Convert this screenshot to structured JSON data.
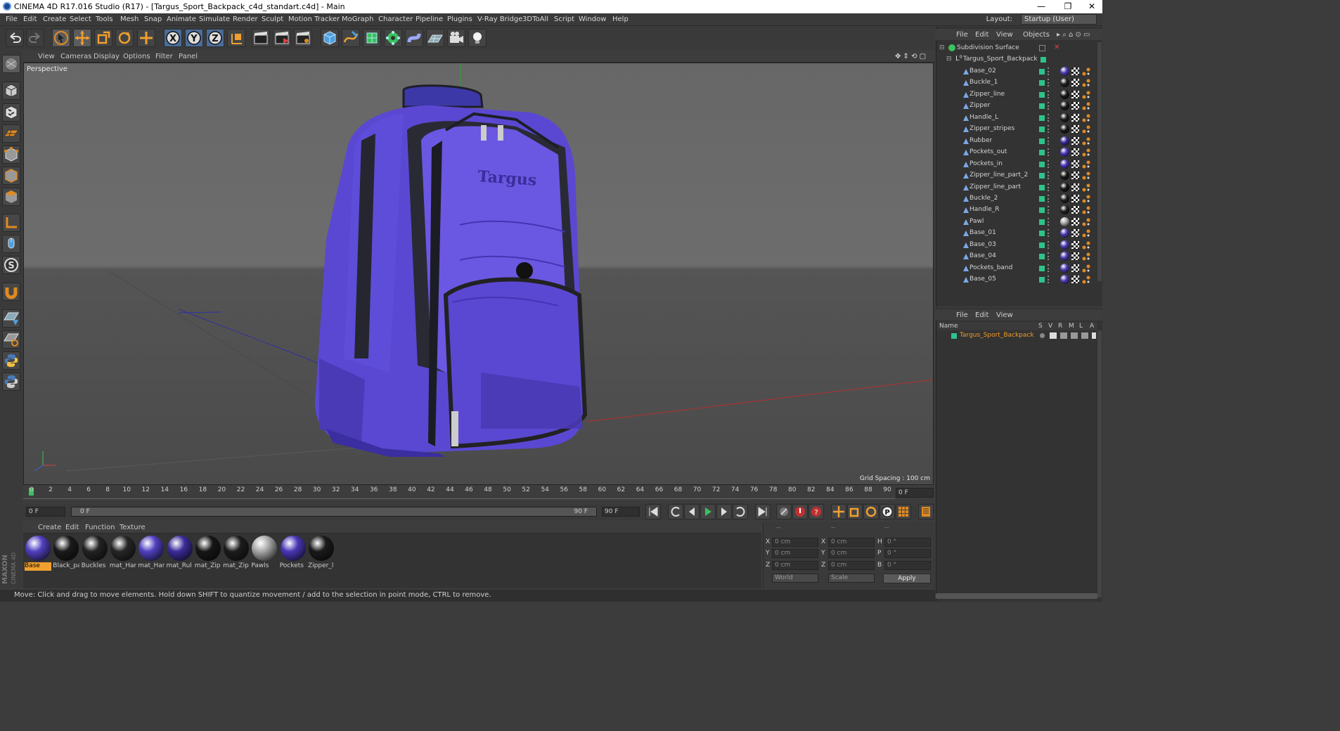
{
  "titlebar": {
    "title": "CINEMA 4D R17.016 Studio (R17) - [Targus_Sport_Backpack_c4d_standart.c4d] - Main",
    "min": "—",
    "restore": "❐",
    "close": "✕"
  },
  "menu": [
    "File",
    "Edit",
    "Create",
    "Select",
    "Tools",
    "Mesh",
    "Snap",
    "Animate",
    "Simulate",
    "Render",
    "Sculpt",
    "Motion Tracker",
    "MoGraph",
    "Character",
    "Pipeline",
    "Plugins",
    "V-Ray Bridge",
    "3DToAll",
    "Script",
    "Window",
    "Help"
  ],
  "layout": {
    "label": "Layout:",
    "value": "Startup (User)"
  },
  "viewport": {
    "menu": [
      "View",
      "Cameras",
      "Display",
      "Options",
      "Filter",
      "Panel"
    ],
    "camera": "Perspective",
    "grid_spacing": "Grid Spacing : 100 cm",
    "model_text": "Targus"
  },
  "timeline": {
    "ticks": [
      "0",
      "2",
      "4",
      "6",
      "8",
      "10",
      "12",
      "14",
      "16",
      "18",
      "20",
      "22",
      "24",
      "26",
      "28",
      "30",
      "32",
      "34",
      "36",
      "38",
      "40",
      "42",
      "44",
      "46",
      "48",
      "50",
      "52",
      "54",
      "56",
      "58",
      "60",
      "62",
      "64",
      "66",
      "68",
      "70",
      "72",
      "74",
      "76",
      "78",
      "80",
      "82",
      "84",
      "86",
      "88",
      "90"
    ],
    "current_frame": "0 F"
  },
  "playback": {
    "start": "0 F",
    "range_start": "0 F",
    "range_end": "90 F",
    "end": "90 F"
  },
  "material_menu": [
    "Create",
    "Edit",
    "Function",
    "Texture"
  ],
  "materials": [
    {
      "name": "Base",
      "color": "#5040c0",
      "selected": true
    },
    {
      "name": "Black_pa",
      "color": "#1a1a1a"
    },
    {
      "name": "Buckles",
      "color": "#222222"
    },
    {
      "name": "mat_Har",
      "color": "#262626"
    },
    {
      "name": "mat_Har",
      "color": "#5040c0"
    },
    {
      "name": "mat_Rul",
      "color": "#3a2c9a"
    },
    {
      "name": "mat_Zip",
      "color": "#161616"
    },
    {
      "name": "mat_Zip",
      "color": "#1c1c1c"
    },
    {
      "name": "Pawls",
      "color": "#a8a8a8"
    },
    {
      "name": "Pockets",
      "color": "#4836b6"
    },
    {
      "name": "Zipper_l",
      "color": "#1a1a1a"
    }
  ],
  "coords": {
    "headers": [
      "--",
      "--",
      "--"
    ],
    "labels": [
      "X",
      "Y",
      "Z",
      "X",
      "Y",
      "Z",
      "H",
      "P",
      "B"
    ],
    "pos": [
      "0 cm",
      "0 cm",
      "0 cm"
    ],
    "size": [
      "0 cm",
      "0 cm",
      "0 cm"
    ],
    "rot": [
      "0 °",
      "0 °",
      "0 °"
    ],
    "mode": "World",
    "scale_mode": "Scale",
    "apply": "Apply"
  },
  "status": "Move: Click and drag to move elements. Hold down SHIFT to quantize movement / add to the selection in point mode, CTRL to remove.",
  "object_manager": {
    "menu": [
      "File",
      "Edit",
      "View",
      "Objects"
    ],
    "root": "Subdivision Surface",
    "group": "Targus_Sport_Backpack",
    "objects": [
      {
        "name": "Base_02",
        "mat": "#4a3cb0"
      },
      {
        "name": "Buckle_1",
        "mat": "#222222"
      },
      {
        "name": "Zipper_line",
        "mat": "#181818"
      },
      {
        "name": "Zipper",
        "mat": "#1c1c1c"
      },
      {
        "name": "Handle_L",
        "mat": "#202020"
      },
      {
        "name": "Zipper_stripes",
        "mat": "#1a1a1a"
      },
      {
        "name": "Rubber",
        "mat": "#3a2c9a"
      },
      {
        "name": "Pockets_out",
        "mat": "#4836b6"
      },
      {
        "name": "Pockets_in",
        "mat": "#4836b6"
      },
      {
        "name": "Zipper_line_part_2",
        "mat": "#181818"
      },
      {
        "name": "Zipper_line_part",
        "mat": "#181818"
      },
      {
        "name": "Buckle_2",
        "mat": "#222222"
      },
      {
        "name": "Handle_R",
        "mat": "#202020"
      },
      {
        "name": "Pawl",
        "mat": "#a8a8a8"
      },
      {
        "name": "Base_01",
        "mat": "#4a3cb0"
      },
      {
        "name": "Base_03",
        "mat": "#4a3cb0"
      },
      {
        "name": "Base_04",
        "mat": "#4a3cb0"
      },
      {
        "name": "Pockets_band",
        "mat": "#4a3cb0"
      },
      {
        "name": "Base_05",
        "mat": "#4a3cb0"
      }
    ]
  },
  "attribute_manager": {
    "menu": [
      "File",
      "Edit",
      "View"
    ],
    "columns": [
      "Name",
      "S",
      "V",
      "R",
      "M",
      "L",
      "A"
    ],
    "layer": "Targus_Sport_Backpack"
  }
}
